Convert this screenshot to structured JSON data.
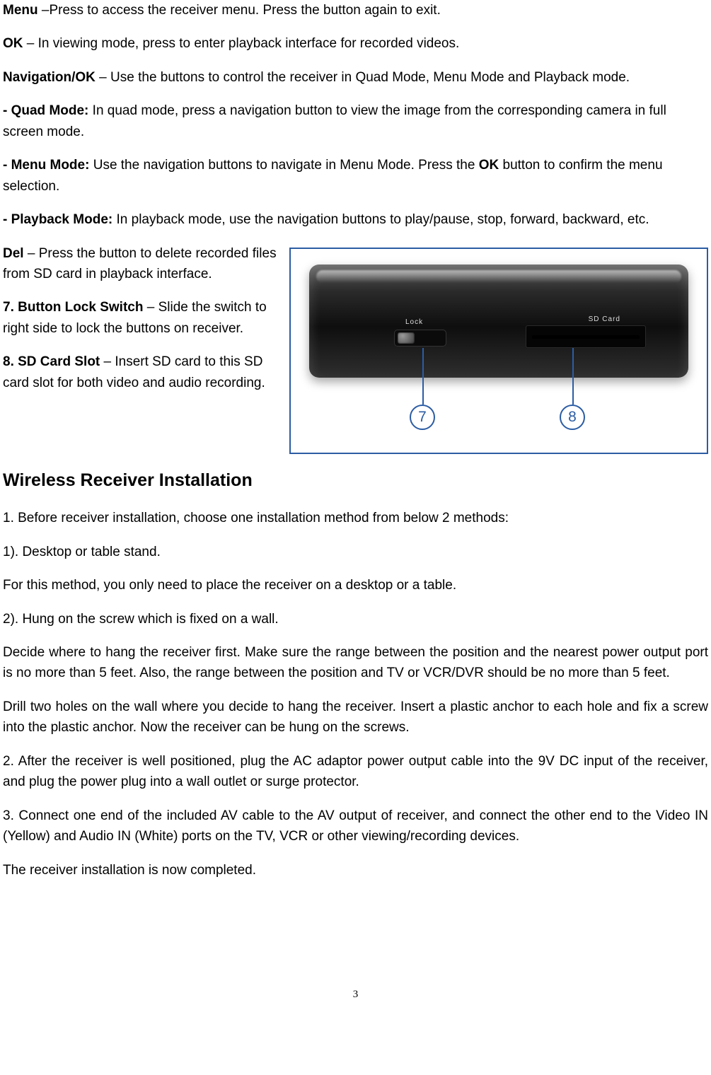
{
  "paragraphs": {
    "menu_label": "Menu ",
    "menu_text": "–Press to access the receiver menu. Press the button again to exit.",
    "ok_label": "OK",
    "ok_text": " – In viewing mode, press to enter playback interface for recorded videos.",
    "navok_label": "Navigation/OK",
    "navok_text": " – Use the buttons to control the receiver in Quad Mode, Menu Mode and Playback mode.",
    "quad_label": "- Quad Mode:",
    "quad_text": " In quad mode, press a navigation button to view the image from the corresponding camera in full screen mode.",
    "menumode_label": "- Menu Mode:",
    "menumode_text_a": " Use the navigation buttons to navigate in Menu Mode. Press the ",
    "menumode_ok": "OK",
    "menumode_text_b": " button to confirm the menu selection.",
    "playback_label": "- Playback Mode:",
    "playback_text": " In playback mode, use the navigation buttons to play/pause, stop, forward, backward, etc.",
    "del_label": "Del",
    "del_text": " – Press the button to delete recorded files from SD card in playback interface.",
    "lock_label": "7. Button Lock Switch",
    "lock_text": " – Slide the switch to right side to lock the buttons on receiver.",
    "sd_label": "8. SD Card Slot",
    "sd_text": " – Insert SD card to this SD card slot for both video and audio recording."
  },
  "figure": {
    "lock_label": "Lock",
    "sd_label": "SD Card",
    "callout7": "7",
    "callout8": "8"
  },
  "heading": "Wireless Receiver Installation",
  "install": {
    "p1": "1. Before receiver installation, choose one installation method from below 2 methods:",
    "p2": "1). Desktop or table stand.",
    "p3": "For this method, you only need to place the receiver on a desktop or a table.",
    "p4": "2). Hung on the screw which is fixed on a wall.",
    "p5": "Decide where to hang the receiver first. Make sure the range between the position and the nearest power output port is no more than 5 feet. Also, the range between the position and TV or VCR/DVR should be no more than 5 feet.",
    "p6": "Drill two holes on the wall where you decide to hang the receiver. Insert a plastic anchor to each hole and fix a screw into the plastic anchor. Now the receiver can be hung on the screws.",
    "p7": "2. After the receiver is well positioned, plug the AC adaptor power output cable into the 9V DC input of the receiver, and plug the power plug into a wall outlet or surge protector.",
    "p8": "3. Connect one end of the included AV cable to the AV output of receiver, and connect the other end to the Video IN (Yellow) and Audio IN (White) ports on the TV, VCR or other viewing/recording devices.",
    "p9": "The receiver installation is now completed."
  },
  "page_number": "3"
}
